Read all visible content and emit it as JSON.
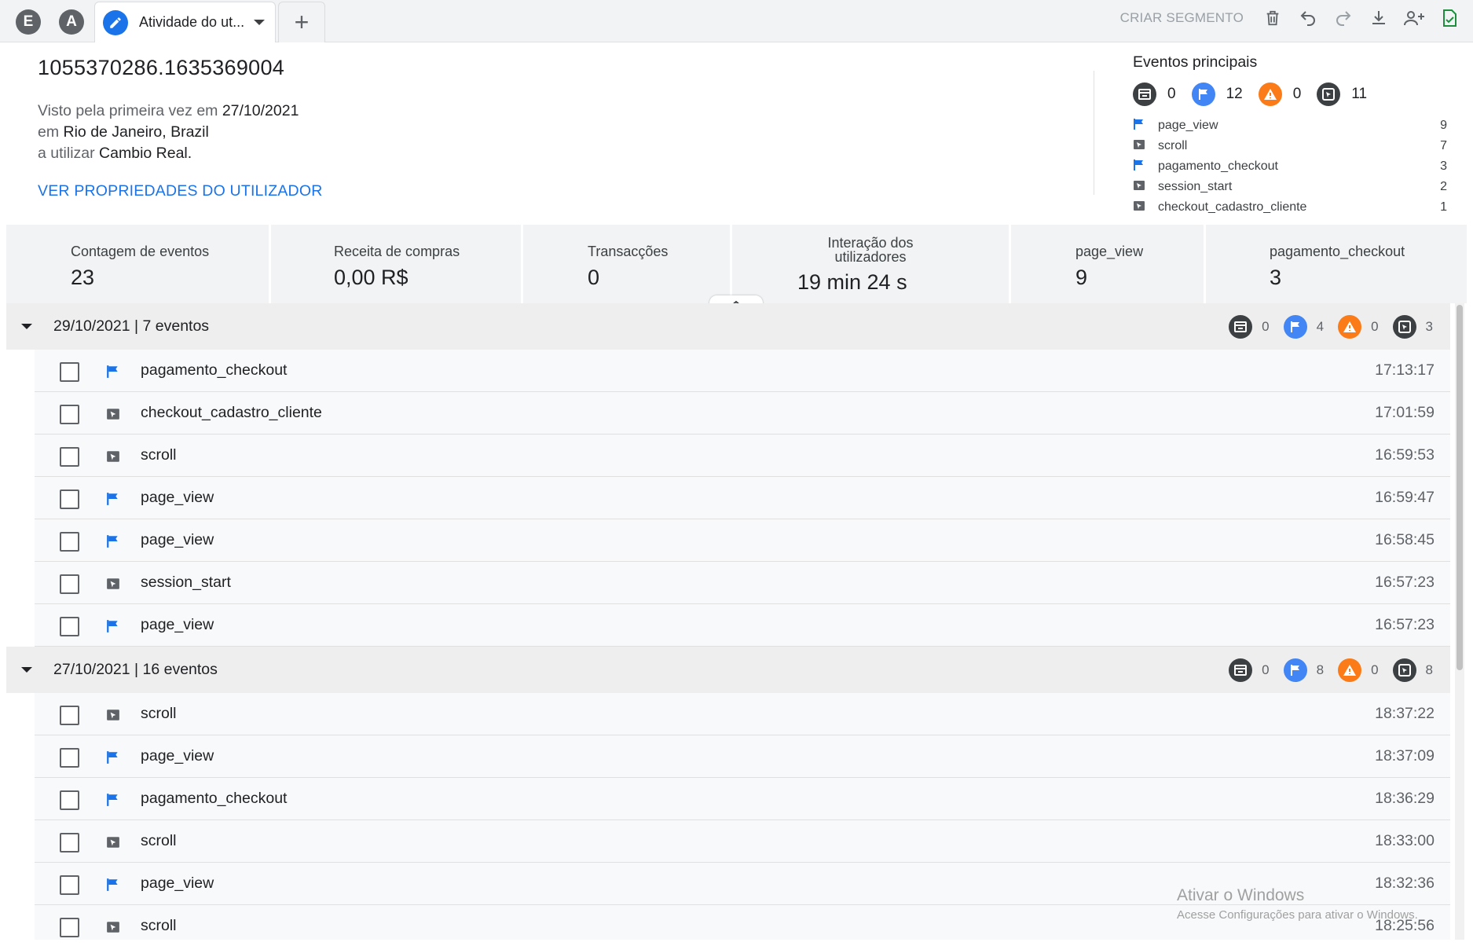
{
  "tabs": {
    "letter_e": "E",
    "letter_a": "A",
    "active_label": "Atividade do ut...",
    "add_symbol": "+"
  },
  "toolbar": {
    "criar_segmento": "CRIAR SEGMENTO"
  },
  "user": {
    "id": "1055370286.1635369004",
    "first_seen_prefix": "Visto pela primeira vez em",
    "first_seen_date": "27/10/2021",
    "location_prefix": "em",
    "location": "Rio de Janeiro, Brazil",
    "platform_prefix": "a utilizar",
    "platform": "Cambio Real.",
    "properties_link": "VER PROPRIEDADES DO UTILIZADOR"
  },
  "top_events": {
    "title": "Eventos principais",
    "counts": [
      "0",
      "12",
      "0",
      "11"
    ],
    "items": [
      {
        "name": "page_view",
        "count": "9",
        "icon": "flag-icon"
      },
      {
        "name": "scroll",
        "count": "7",
        "icon": "cursor-icon"
      },
      {
        "name": "pagamento_checkout",
        "count": "3",
        "icon": "flag-icon"
      },
      {
        "name": "session_start",
        "count": "2",
        "icon": "cursor-icon"
      },
      {
        "name": "checkout_cadastro_cliente",
        "count": "1",
        "icon": "cursor-icon"
      }
    ]
  },
  "metrics": [
    {
      "label": "Contagem de eventos",
      "value": "23"
    },
    {
      "label": "Receita de compras",
      "value": "0,00 R$"
    },
    {
      "label": "Transacções",
      "value": "0"
    },
    {
      "label": "Interação dos utilizadores",
      "value": "19 min 24 s"
    },
    {
      "label": "page_view",
      "value": "9"
    },
    {
      "label": "pagamento_checkout",
      "value": "3"
    }
  ],
  "days": [
    {
      "title": "29/10/2021 | 7 eventos",
      "counts": [
        "0",
        "4",
        "0",
        "3"
      ],
      "events": [
        {
          "name": "pagamento_checkout",
          "time": "17:13:17",
          "icon": "flag-icon"
        },
        {
          "name": "checkout_cadastro_cliente",
          "time": "17:01:59",
          "icon": "cursor-icon"
        },
        {
          "name": "scroll",
          "time": "16:59:53",
          "icon": "cursor-icon"
        },
        {
          "name": "page_view",
          "time": "16:59:47",
          "icon": "flag-icon"
        },
        {
          "name": "page_view",
          "time": "16:58:45",
          "icon": "flag-icon"
        },
        {
          "name": "session_start",
          "time": "16:57:23",
          "icon": "cursor-icon"
        },
        {
          "name": "page_view",
          "time": "16:57:23",
          "icon": "flag-icon"
        }
      ]
    },
    {
      "title": "27/10/2021 | 16 eventos",
      "counts": [
        "0",
        "8",
        "0",
        "8"
      ],
      "events": [
        {
          "name": "scroll",
          "time": "18:37:22",
          "icon": "cursor-icon"
        },
        {
          "name": "page_view",
          "time": "18:37:09",
          "icon": "flag-icon"
        },
        {
          "name": "pagamento_checkout",
          "time": "18:36:29",
          "icon": "flag-icon"
        },
        {
          "name": "scroll",
          "time": "18:33:00",
          "icon": "cursor-icon"
        },
        {
          "name": "page_view",
          "time": "18:32:36",
          "icon": "flag-icon"
        },
        {
          "name": "scroll",
          "time": "18:25:56",
          "icon": "cursor-icon"
        }
      ]
    }
  ],
  "watermark": {
    "line1": "Ativar o Windows",
    "line2": "Acesse Configurações para ativar o Windows."
  },
  "colors": {
    "accent_blue": "#1a73e8",
    "flag_blue": "#4285f4",
    "warning_orange": "#fa7b17",
    "dark_badge": "#3c4043"
  }
}
